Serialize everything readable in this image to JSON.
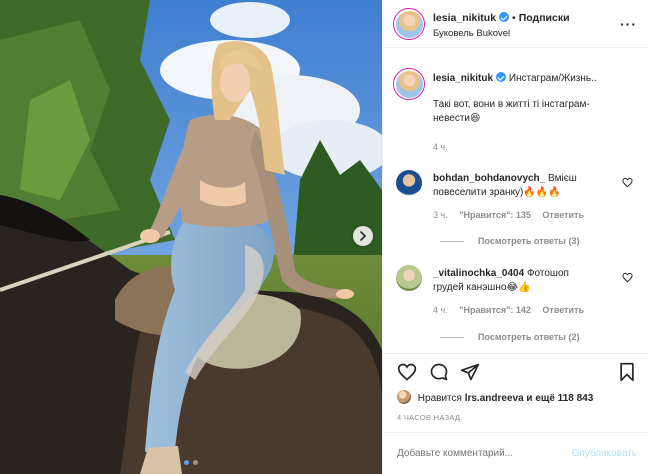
{
  "header": {
    "username": "lesia_nikituk",
    "separator": "•",
    "follow_label": "Подписки",
    "location": "Буковель Bukovel"
  },
  "caption": {
    "username": "lesia_nikituk",
    "title": "Инстаграм/Жизнь..",
    "text": "Такі вот, вони в житті ті інстаграм-невести",
    "emoji": "😆",
    "time": "4 ч."
  },
  "comments": [
    {
      "username": "bohdan_bohdanovych_",
      "text_line1": "Вмієш",
      "text_line2": "повеселити зранку)",
      "emoji": "🔥🔥🔥",
      "time": "3 ч.",
      "likes": "\"Нравится\": 135",
      "reply": "Ответить",
      "view_replies": "Посмотреть ответы (3)"
    },
    {
      "username": "_vitalinochka_0404",
      "text_line1": "Фотошоп",
      "text_line2": "грудей канэшно",
      "emoji": "😂👍",
      "time": "4 ч.",
      "likes": "\"Нравится\": 142",
      "reply": "Ответить",
      "view_replies": "Посмотреть ответы (2)"
    }
  ],
  "likes": {
    "prefix": "Нравится",
    "user": "lrs.andreeva",
    "suffix": "и ещё 118 843"
  },
  "timestamp": "4 ЧАСОВ НАЗАД",
  "add_comment": {
    "placeholder": "Добавьте комментарий...",
    "post_label": "Опубликовать"
  },
  "colors": {
    "accent": "#3897f0",
    "muted": "#8e8e8e",
    "text": "#262626",
    "post_disabled": "#b2dffc"
  },
  "icons": [
    "heart-icon",
    "comment-icon",
    "share-icon",
    "bookmark-icon",
    "more-icon",
    "verified-icon",
    "chevron-right-icon"
  ]
}
